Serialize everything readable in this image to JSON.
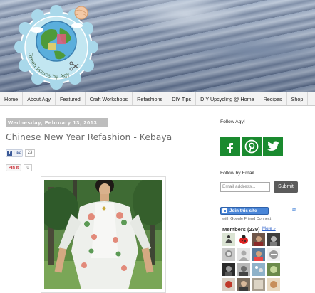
{
  "logo": {
    "text": "Green Issues by Agy"
  },
  "nav": {
    "items": [
      "Home",
      "About Agy",
      "Featured",
      "Craft Workshops",
      "Refashions",
      "DIY Tips",
      "DIY Upcycling @ Home",
      "Recipes",
      "Shop"
    ]
  },
  "post": {
    "date": "Wednesday, February 13, 2013",
    "title": "Chinese New Year Refashion - Kebaya",
    "like_label": "Like",
    "like_count": "23",
    "pin_label": "Pin it",
    "pin_count": "0"
  },
  "sidebar": {
    "follow_heading": "Follow Agy!",
    "social_icons": [
      "facebook-icon",
      "pinterest-icon",
      "twitter-icon"
    ],
    "email_heading": "Follow by Email",
    "email_placeholder": "Email address...",
    "submit_label": "Submit",
    "join_label": "Join this site",
    "gfc_subtext": "with Google Friend Connect",
    "members_label": "Members (239)",
    "more_label": "More »"
  },
  "colors": {
    "social_green": "#1a8a2f",
    "logo_blue": "#a9d8ea",
    "join_blue": "#4a86d8"
  }
}
